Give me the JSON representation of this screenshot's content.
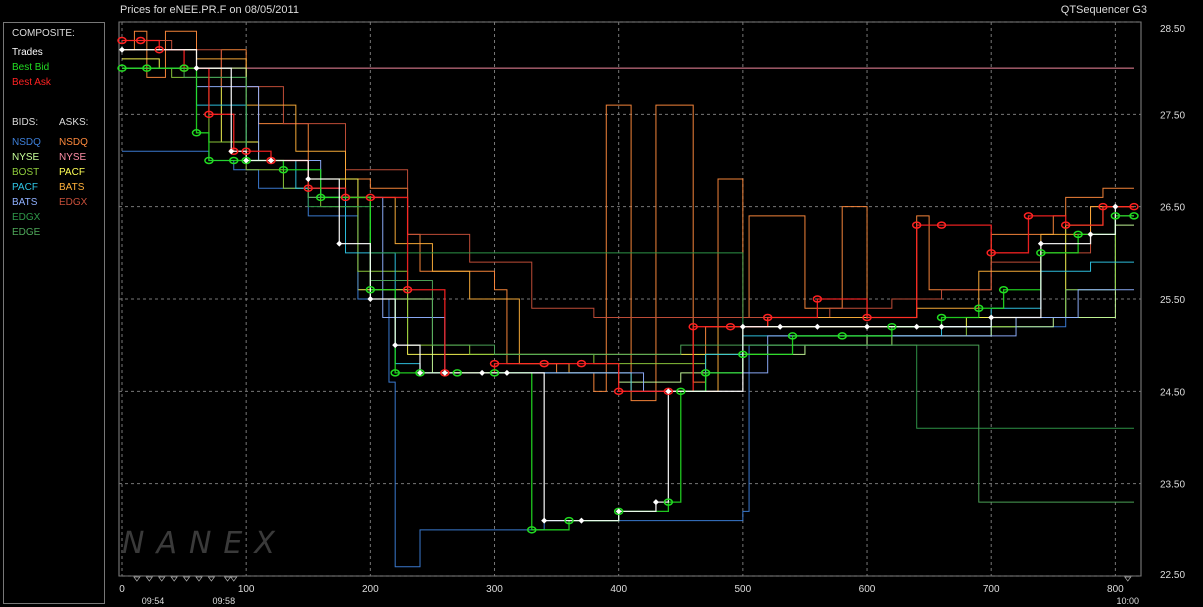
{
  "header": {
    "title": "Prices for  eNEE.PR.F  on  08/05/2011",
    "app": "QTSequencer G3"
  },
  "legend": {
    "composite_label": "COMPOSITE:",
    "trades": "Trades",
    "best_bid": "Best Bid",
    "best_ask": "Best Ask",
    "bids_label": "BIDS:",
    "asks_label": "ASKS:",
    "bids": [
      {
        "name": "NSDQ",
        "color": "#3d7fd9"
      },
      {
        "name": "NYSE",
        "color": "#c8ff9a"
      },
      {
        "name": "BOST",
        "color": "#8fcc3c"
      },
      {
        "name": "PACF",
        "color": "#2fc6e6"
      },
      {
        "name": "BATS",
        "color": "#8fb0ff"
      },
      {
        "name": "EDGX",
        "color": "#2f9a4a"
      },
      {
        "name": "EDGE",
        "color": "#4ea85a"
      }
    ],
    "asks": [
      {
        "name": "NSDQ",
        "color": "#ff8a3c"
      },
      {
        "name": "NYSE",
        "color": "#ff8fa6"
      },
      {
        "name": "PACF",
        "color": "#ffff55"
      },
      {
        "name": "BATS",
        "color": "#ffb03a"
      },
      {
        "name": "EDGX",
        "color": "#c8503a"
      }
    ],
    "colors": {
      "trades": "#ffffff",
      "best_bid": "#22dd22",
      "best_ask": "#ff2222"
    }
  },
  "watermark": "NANEX",
  "chart_data": {
    "type": "line",
    "title": "Prices for  eNEE.PR.F  on  08/05/2011",
    "xlim": [
      0,
      815
    ],
    "ylim": [
      22.5,
      28.5
    ],
    "x_ticks": [
      "0",
      "100",
      "200",
      "300",
      "400",
      "500",
      "600",
      "700",
      "800"
    ],
    "y_ticks": [
      "28.50",
      "27.50",
      "26.50",
      "25.50",
      "24.50",
      "23.50",
      "22.50"
    ],
    "time_labels": [
      {
        "x": 25,
        "label": "09:54"
      },
      {
        "x": 82,
        "label": "09:58"
      },
      {
        "x": 810,
        "label": "10:00"
      }
    ],
    "grid": true,
    "series": [
      {
        "name": "NSDQ",
        "side": "ask",
        "color": "#ff8a3c",
        "x": [
          0,
          10,
          20,
          35,
          60,
          80,
          100,
          110,
          150,
          200,
          230,
          240,
          300,
          310,
          350,
          380,
          390,
          410,
          430,
          460,
          470,
          480,
          500,
          505,
          550,
          580,
          600,
          640,
          650,
          700,
          750,
          760,
          790,
          815
        ],
        "y": [
          28.2,
          28.4,
          27.9,
          28.4,
          28.0,
          28.2,
          27.8,
          27.4,
          26.8,
          26.7,
          26.2,
          25.8,
          25.6,
          24.8,
          24.7,
          24.5,
          27.6,
          24.4,
          27.6,
          24.6,
          25.2,
          26.8,
          25.3,
          26.4,
          25.4,
          26.5,
          25.3,
          26.4,
          25.6,
          26.2,
          26.4,
          26.6,
          26.7,
          26.7
        ]
      },
      {
        "name": "NYSE",
        "side": "ask",
        "color": "#ff8fa6",
        "x": [
          0,
          20,
          40,
          60,
          80,
          100,
          120,
          150,
          200,
          240,
          300,
          340,
          400,
          460,
          500,
          560,
          620,
          680,
          730,
          780,
          815
        ],
        "y": [
          28.0,
          28.0,
          28.0,
          28.0,
          28.0,
          28.0,
          28.0,
          28.0,
          28.0,
          28.0,
          28.0,
          28.0,
          28.0,
          28.0,
          28.0,
          28.0,
          28.0,
          28.0,
          28.0,
          28.0,
          28.0
        ]
      },
      {
        "name": "PACF",
        "side": "ask",
        "color": "#ffff55",
        "x": [
          0,
          30,
          55,
          80,
          110,
          150,
          190,
          230,
          260,
          300,
          340,
          370,
          400,
          440,
          470,
          500,
          530,
          560,
          600,
          640,
          680,
          720,
          760,
          790,
          815
        ],
        "y": [
          28.1,
          28.0,
          28.0,
          27.2,
          27.0,
          26.8,
          25.6,
          24.9,
          24.9,
          24.9,
          24.9,
          24.9,
          24.9,
          24.9,
          24.9,
          25.2,
          25.2,
          25.2,
          25.2,
          25.2,
          25.3,
          25.3,
          26.3,
          26.5,
          26.5
        ]
      },
      {
        "name": "EDGX",
        "side": "ask",
        "color": "#c8503a",
        "x": [
          0,
          40,
          80,
          130,
          180,
          230,
          280,
          330,
          380,
          420,
          470,
          520,
          570,
          620,
          660,
          700,
          740,
          780,
          815
        ],
        "y": [
          28.3,
          28.2,
          27.8,
          27.4,
          26.9,
          26.2,
          25.9,
          25.4,
          25.3,
          25.3,
          25.3,
          25.3,
          25.4,
          25.5,
          25.6,
          25.9,
          26.0,
          26.5,
          26.5
        ]
      },
      {
        "name": "BATS",
        "side": "ask",
        "color": "#ffb03a",
        "x": [
          0,
          60,
          100,
          140,
          180,
          220,
          250,
          280,
          320,
          360,
          410,
          440,
          480,
          520,
          560,
          600,
          640,
          690,
          740,
          780,
          815
        ],
        "y": [
          28.2,
          28.1,
          27.6,
          27.1,
          26.6,
          26.1,
          25.8,
          25.5,
          24.8,
          24.7,
          24.5,
          24.5,
          25.2,
          25.3,
          25.3,
          25.3,
          25.4,
          25.8,
          26.2,
          26.5,
          26.5
        ]
      },
      {
        "name": "NSDQ",
        "side": "bid",
        "color": "#3d7fd9",
        "x": [
          0,
          8,
          40,
          70,
          90,
          110,
          150,
          190,
          215,
          220,
          240,
          330,
          340,
          500,
          505,
          560,
          620,
          700,
          760,
          800,
          815
        ],
        "y": [
          27.1,
          27.1,
          27.1,
          27.0,
          26.9,
          26.7,
          26.4,
          25.5,
          24.6,
          22.6,
          23.0,
          23.0,
          23.1,
          23.2,
          25.0,
          25.0,
          25.1,
          25.2,
          25.6,
          26.4,
          26.4
        ]
      },
      {
        "name": "NYSE",
        "side": "bid",
        "color": "#c8ff9a",
        "x": [
          0,
          50,
          100,
          150,
          200,
          250,
          300,
          350,
          400,
          450,
          500,
          550,
          600,
          650,
          700,
          750,
          800,
          815
        ],
        "y": [
          28.0,
          28.0,
          27.0,
          26.6,
          25.5,
          24.7,
          24.7,
          24.7,
          24.6,
          24.7,
          24.9,
          25.0,
          25.1,
          25.1,
          25.2,
          25.3,
          26.3,
          26.3
        ]
      },
      {
        "name": "BOST",
        "side": "bid",
        "color": "#8fcc3c",
        "x": [
          0,
          40,
          70,
          100,
          130,
          160,
          190,
          230,
          280,
          330,
          380,
          430,
          470,
          520,
          570,
          620,
          680,
          720,
          760,
          800,
          815
        ],
        "y": [
          28.0,
          27.9,
          27.2,
          26.9,
          26.7,
          26.5,
          25.8,
          25.0,
          24.9,
          24.9,
          24.8,
          24.8,
          24.9,
          25.0,
          25.0,
          25.1,
          25.2,
          25.3,
          25.6,
          26.4,
          26.4
        ]
      },
      {
        "name": "PACF",
        "side": "bid",
        "color": "#2fc6e6",
        "x": [
          0,
          60,
          100,
          140,
          180,
          220,
          240,
          280,
          320,
          360,
          410,
          450,
          470,
          500,
          540,
          580,
          620,
          660,
          700,
          740,
          780,
          815
        ],
        "y": [
          28.0,
          27.6,
          27.0,
          26.7,
          26.0,
          24.8,
          24.7,
          24.7,
          24.7,
          24.7,
          24.5,
          24.5,
          24.9,
          25.1,
          25.1,
          25.1,
          25.1,
          25.2,
          25.4,
          25.8,
          25.9,
          25.9
        ]
      },
      {
        "name": "BATS",
        "side": "bid",
        "color": "#8fb0ff",
        "x": [
          0,
          60,
          110,
          160,
          210,
          260,
          310,
          360,
          420,
          470,
          520,
          570,
          620,
          670,
          720,
          770,
          815
        ],
        "y": [
          28.0,
          27.8,
          27.0,
          26.6,
          25.3,
          24.7,
          24.7,
          24.7,
          24.5,
          24.7,
          25.1,
          25.1,
          25.1,
          25.1,
          25.3,
          25.6,
          25.6
        ]
      },
      {
        "name": "EDGX",
        "side": "bid",
        "color": "#2f9a4a",
        "x": [
          0,
          60,
          100,
          150,
          200,
          250,
          300,
          350,
          400,
          450,
          500,
          550,
          600,
          615,
          640,
          680,
          700,
          720,
          760,
          815
        ],
        "y": [
          28.0,
          27.9,
          27.0,
          26.5,
          26.0,
          26.0,
          26.0,
          26.0,
          26.0,
          26.0,
          25.0,
          25.0,
          25.0,
          25.0,
          24.1,
          24.1,
          24.1,
          24.1,
          24.1,
          24.1
        ]
      },
      {
        "name": "EDGE",
        "side": "bid",
        "color": "#4ea85a",
        "x": [
          0,
          50,
          100,
          150,
          200,
          250,
          300,
          350,
          400,
          450,
          500,
          550,
          600,
          650,
          680,
          690,
          720,
          760,
          815
        ],
        "y": [
          28.0,
          27.9,
          27.0,
          26.6,
          25.7,
          25.0,
          24.9,
          24.9,
          24.9,
          25.0,
          25.0,
          25.0,
          25.0,
          25.0,
          25.0,
          23.3,
          23.3,
          23.3,
          23.3
        ]
      },
      {
        "name": "Best Ask",
        "side": "composite",
        "color": "#ff2222",
        "x": [
          0,
          15,
          30,
          50,
          70,
          90,
          100,
          120,
          150,
          180,
          200,
          230,
          260,
          300,
          340,
          370,
          400,
          440,
          460,
          490,
          520,
          560,
          600,
          640,
          660,
          700,
          730,
          760,
          790,
          815
        ],
        "y": [
          28.3,
          28.3,
          28.2,
          28.0,
          27.5,
          27.1,
          27.1,
          27.0,
          26.7,
          26.6,
          26.6,
          25.6,
          24.7,
          24.8,
          24.8,
          24.8,
          24.5,
          24.5,
          25.2,
          25.2,
          25.3,
          25.5,
          25.3,
          26.3,
          26.3,
          26.0,
          26.4,
          26.3,
          26.5,
          26.5
        ]
      },
      {
        "name": "Best Bid",
        "side": "composite",
        "color": "#22dd22",
        "x": [
          0,
          20,
          50,
          60,
          70,
          90,
          100,
          130,
          160,
          200,
          220,
          240,
          270,
          300,
          330,
          360,
          400,
          440,
          450,
          470,
          500,
          540,
          580,
          620,
          660,
          690,
          710,
          740,
          770,
          800,
          815
        ],
        "y": [
          28.0,
          28.0,
          28.0,
          27.3,
          27.0,
          27.0,
          27.0,
          26.9,
          26.6,
          25.6,
          24.7,
          24.7,
          24.7,
          24.7,
          23.0,
          23.1,
          23.2,
          23.3,
          24.5,
          24.7,
          24.9,
          25.1,
          25.1,
          25.2,
          25.3,
          25.4,
          25.6,
          26.0,
          26.2,
          26.4,
          26.4
        ]
      },
      {
        "name": "Trades",
        "side": "composite",
        "color": "#ffffff",
        "x": [
          0,
          60,
          88,
          100,
          120,
          150,
          175,
          200,
          220,
          240,
          260,
          290,
          310,
          340,
          370,
          400,
          430,
          440,
          500,
          530,
          560,
          600,
          640,
          660,
          700,
          740,
          780,
          800
        ],
        "y": [
          28.2,
          28.0,
          27.1,
          27.0,
          27.0,
          26.8,
          26.1,
          25.5,
          25.0,
          24.7,
          24.7,
          24.7,
          24.7,
          23.1,
          23.1,
          23.2,
          23.3,
          24.5,
          25.2,
          25.2,
          25.2,
          25.2,
          25.2,
          25.2,
          25.3,
          26.1,
          26.2,
          26.5
        ]
      }
    ]
  }
}
